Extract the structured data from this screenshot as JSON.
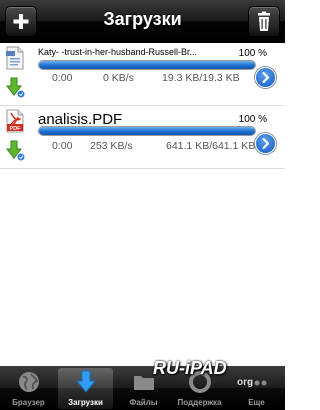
{
  "navbar": {
    "title": "Загрузки",
    "add_icon": "plus-icon",
    "trash_icon": "trash-icon"
  },
  "downloads": [
    {
      "filename": "Katy-        -trust-in-her-husband-Russell-Br...",
      "percent": "100 %",
      "progress": 1.0,
      "elapsed": "0:00",
      "speed": "0 KB/s",
      "size": "19.3 KB/19.3 KB",
      "file_icon": "document-icon",
      "status_icon": "download-arrow-icon"
    },
    {
      "filename": "analisis.PDF",
      "percent": "100 %",
      "progress": 1.0,
      "elapsed": "0:00",
      "speed": "253 KB/s",
      "size": "641.1 KB/641.1 KB",
      "file_icon": "pdf-icon",
      "status_icon": "download-arrow-icon"
    }
  ],
  "tabbar": {
    "items": [
      {
        "label": "Браузер",
        "icon": "globe-icon"
      },
      {
        "label": "Загрузки",
        "icon": "download-icon"
      },
      {
        "label": "Файлы",
        "icon": "folder-icon"
      },
      {
        "label": "Поддержка",
        "icon": "support-icon"
      },
      {
        "label": "Еще",
        "icon": "more-icon"
      }
    ],
    "selected": "Загрузки"
  },
  "watermark": {
    "text": "RU-iPAD",
    "suffix": "org"
  },
  "colors": {
    "progress": "#1a6fd0",
    "detail_button": "#1257c4",
    "bar_dark": "#000000"
  }
}
